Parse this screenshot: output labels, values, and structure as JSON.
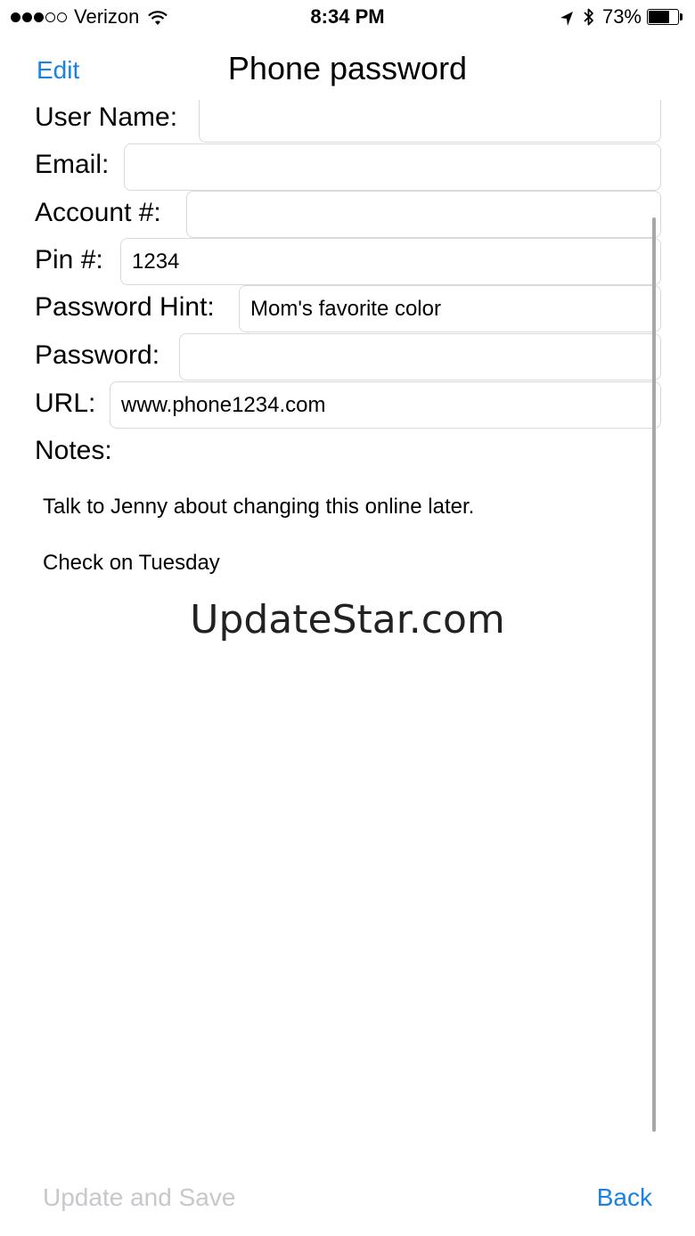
{
  "status_bar": {
    "carrier": "Verizon",
    "signal_bars_filled": 3,
    "signal_bars_total": 5,
    "time": "8:34 PM",
    "battery_percent_label": "73%",
    "battery_level": 0.73
  },
  "nav": {
    "edit_label": "Edit",
    "title": "Phone password"
  },
  "form": {
    "user_name": {
      "label": "User Name:",
      "value": ""
    },
    "email": {
      "label": "Email:",
      "value": ""
    },
    "account": {
      "label": "Account #:",
      "value": ""
    },
    "pin": {
      "label": "Pin #:",
      "value": "1234"
    },
    "password_hint": {
      "label": "Password Hint:",
      "value": "Mom's favorite color"
    },
    "password": {
      "label": "Password:",
      "value": ""
    },
    "url": {
      "label": "URL:",
      "value": "www.phone1234.com"
    }
  },
  "notes": {
    "label": "Notes:",
    "line1": "Talk to Jenny about changing this online later.",
    "line2": "Check on Tuesday"
  },
  "watermark": "UpdateStar.com",
  "toolbar": {
    "update_save_label": "Update and Save",
    "back_label": "Back"
  },
  "colors": {
    "accent": "#1a82e2",
    "disabled": "#c7c7cc"
  }
}
